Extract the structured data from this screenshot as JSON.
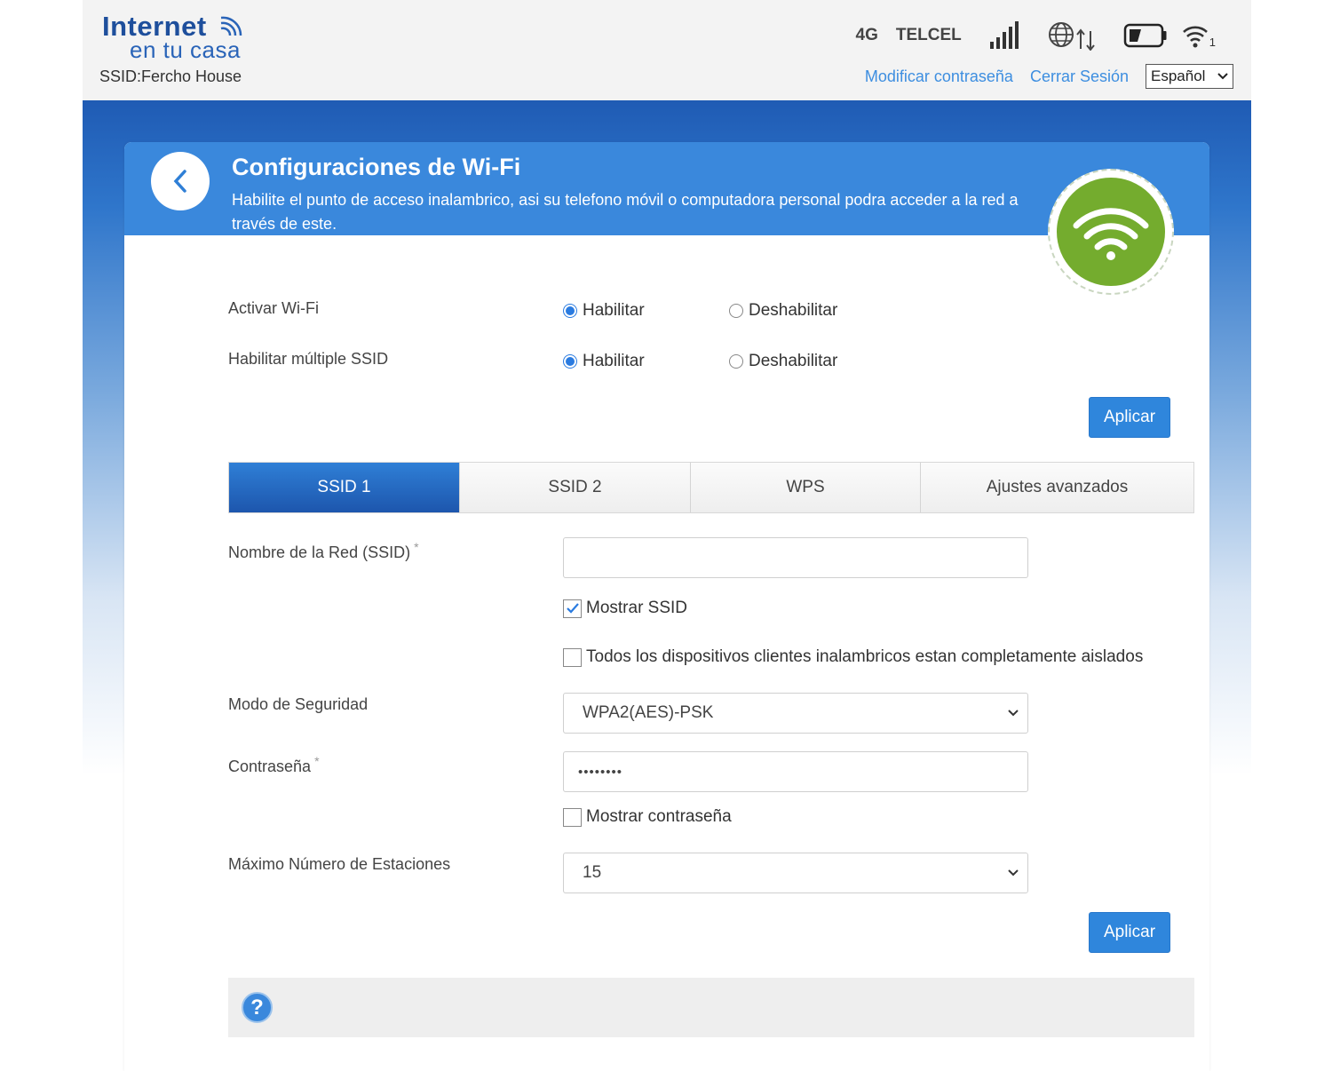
{
  "header": {
    "logo_line1": "Internet",
    "logo_line2": "en tu casa",
    "ssid_label": "SSID:Fercho House",
    "network_type": "4G",
    "carrier": "TELCEL",
    "wifi_clients": "1",
    "change_password": "Modificar contraseña",
    "logout": "Cerrar Sesión",
    "language": "Español",
    "icons": [
      "signal-bars-icon",
      "globe-data-icon",
      "battery-icon",
      "wifi-clients-icon"
    ]
  },
  "banner": {
    "title": "Configuraciones de Wi-Fi",
    "subtitle": "Habilite el punto de acceso inalambrico, asi su telefono móvil o computadora personal podra acceder a la red a través de este.",
    "accent_color": "#3a88dc",
    "badge_color": "#74ac2e"
  },
  "settings": {
    "wifi_label": "Activar Wi-Fi",
    "multi_ssid_label": "Habilitar múltiple SSID",
    "enable": "Habilitar",
    "disable": "Deshabilitar",
    "wifi_enabled": true,
    "multi_ssid_enabled": true,
    "apply": "Aplicar"
  },
  "tabs": [
    {
      "label": "SSID 1",
      "active": true
    },
    {
      "label": "SSID 2",
      "active": false
    },
    {
      "label": "WPS",
      "active": false
    },
    {
      "label": "Ajustes avanzados",
      "active": false
    }
  ],
  "form": {
    "ssid_name_label": "Nombre de la Red (SSID)",
    "required_mark": "*",
    "ssid_name_value": "",
    "show_ssid_label": "Mostrar SSID",
    "show_ssid_checked": true,
    "isolation_label": "Todos los dispositivos clientes inalambricos estan completamente aislados",
    "isolation_checked": false,
    "security_label": "Modo de Seguridad",
    "security_value": "WPA2(AES)-PSK",
    "password_label": "Contraseña",
    "password_value": "••••••••",
    "show_password_label": "Mostrar contraseña",
    "show_password_checked": false,
    "max_stations_label": "Máximo Número de Estaciones",
    "max_stations_value": "15",
    "apply": "Aplicar"
  },
  "help": {
    "symbol": "?"
  }
}
